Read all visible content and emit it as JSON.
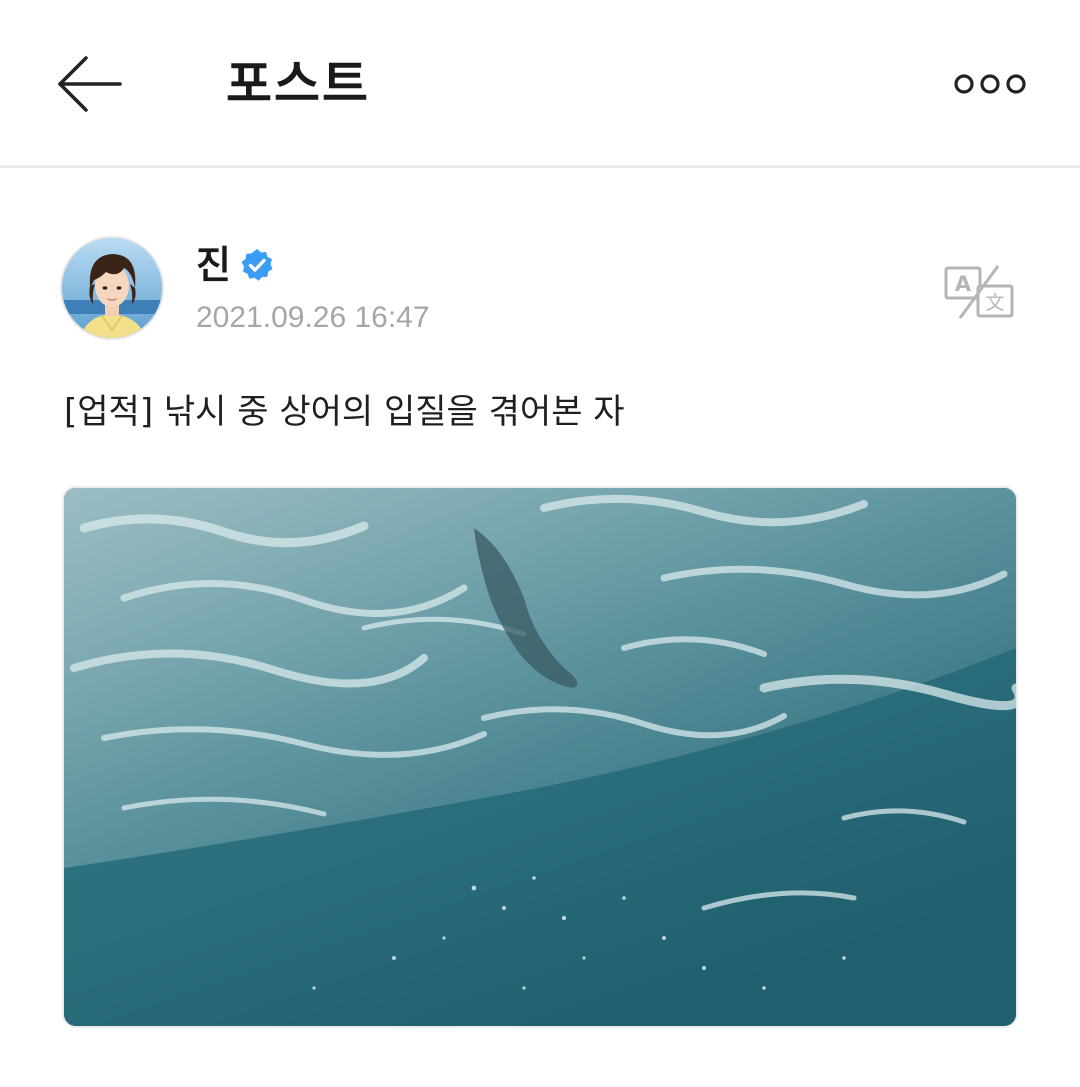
{
  "header": {
    "title": "포스트",
    "back_icon": "arrow-left-icon",
    "more_icon": "more-horizontal-icon"
  },
  "post": {
    "author": {
      "name": "진",
      "verified": true,
      "verified_color": "#3b9cf5",
      "avatar_icon": "profile-photo"
    },
    "timestamp": "2021.09.26 16:47",
    "translate_icon": "translate-icon",
    "text": "[업적] 낚시 중 상어의 입질을 겪어본 자",
    "media": {
      "type": "image",
      "icon": "ocean-photo"
    }
  },
  "colors": {
    "text_primary": "#1a1a1a",
    "text_secondary": "#a6a6a6",
    "divider": "#ececec",
    "water": "#2b6f7b"
  }
}
